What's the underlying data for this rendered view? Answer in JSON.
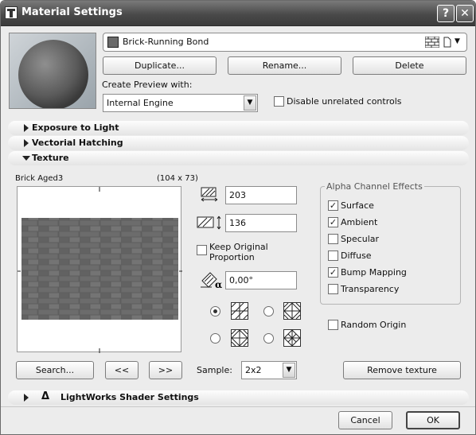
{
  "title": "Material Settings",
  "title_buttons": {
    "help": "?",
    "close": "✕"
  },
  "material": {
    "name": "Brick-Running Bond",
    "swatch_color": "#6a6a6a"
  },
  "buttons": {
    "duplicate": "Duplicate...",
    "rename": "Rename...",
    "delete": "Delete",
    "search": "Search...",
    "prev": "<<",
    "next": ">>",
    "remove_texture": "Remove texture",
    "cancel": "Cancel",
    "ok": "OK"
  },
  "preview": {
    "label": "Create Preview with:",
    "engine": "Internal Engine",
    "disable_label": "Disable unrelated controls",
    "disable_checked": false
  },
  "sections": {
    "exposure": "Exposure to Light",
    "vectorial": "Vectorial Hatching",
    "texture": "Texture",
    "lightworks": "LightWorks Shader Settings"
  },
  "texture": {
    "name": "Brick Aged3",
    "size": "(104 x 73)",
    "width": "203",
    "height": "136",
    "keep_label_1": "Keep Original",
    "keep_label_2": "Proportion",
    "keep_checked": false,
    "angle": "0,00°",
    "sample_label": "Sample:",
    "sample_value": "2x2"
  },
  "alpha": {
    "title": "Alpha Channel Effects",
    "items": [
      {
        "label": "Surface",
        "checked": true
      },
      {
        "label": "Ambient",
        "checked": true
      },
      {
        "label": "Specular",
        "checked": false
      },
      {
        "label": "Diffuse",
        "checked": false
      },
      {
        "label": "Bump Mapping",
        "checked": true
      },
      {
        "label": "Transparency",
        "checked": false
      }
    ]
  },
  "random_origin": {
    "label": "Random Origin",
    "checked": false
  },
  "mirror_options": {
    "selected": 0
  },
  "icons": {
    "delta": "Δ",
    "check": "✓"
  }
}
